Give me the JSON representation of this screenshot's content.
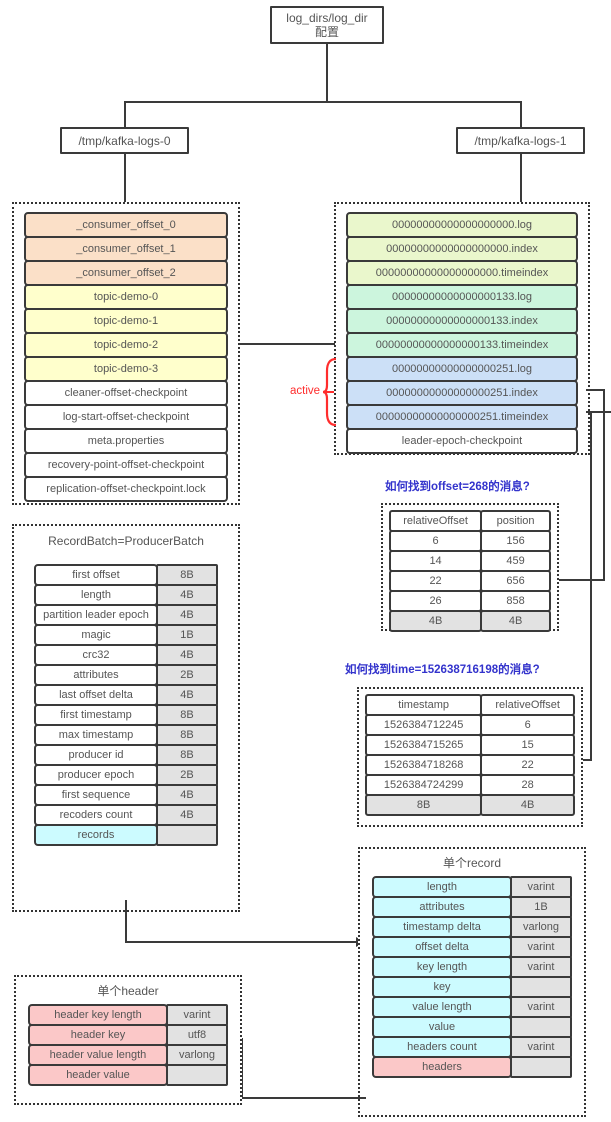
{
  "root": {
    "line1": "log_dirs/log_dir",
    "line2": "配置"
  },
  "dirs": {
    "left": "/tmp/kafka-logs-0",
    "right": "/tmp/kafka-logs-1"
  },
  "left_dir_files": [
    {
      "name": "_consumer_offset_0",
      "color": "#fbe0c8"
    },
    {
      "name": "_consumer_offset_1",
      "color": "#fbe0c8"
    },
    {
      "name": "_consumer_offset_2",
      "color": "#fbe0c8"
    },
    {
      "name": "topic-demo-0",
      "color": "#ffffcc"
    },
    {
      "name": "topic-demo-1",
      "color": "#ffffcc"
    },
    {
      "name": "topic-demo-2",
      "color": "#ffffcc"
    },
    {
      "name": "topic-demo-3",
      "color": "#ffffcc"
    },
    {
      "name": "cleaner-offset-checkpoint",
      "color": "#ffffff"
    },
    {
      "name": "log-start-offset-checkpoint",
      "color": "#ffffff"
    },
    {
      "name": "meta.properties",
      "color": "#ffffff"
    },
    {
      "name": "recovery-point-offset-checkpoint",
      "color": "#ffffff"
    },
    {
      "name": "replication-offset-checkpoint.lock",
      "color": "#ffffff"
    }
  ],
  "partition_files": [
    {
      "name": "00000000000000000000.log",
      "color": "#eaf7cc"
    },
    {
      "name": "00000000000000000000.index",
      "color": "#eaf7cc"
    },
    {
      "name": "00000000000000000000.timeindex",
      "color": "#eaf7cc"
    },
    {
      "name": "00000000000000000133.log",
      "color": "#ccf5dd"
    },
    {
      "name": "00000000000000000133.index",
      "color": "#ccf5dd"
    },
    {
      "name": "00000000000000000133.timeindex",
      "color": "#ccf5dd"
    },
    {
      "name": "00000000000000000251.log",
      "color": "#cce0f7"
    },
    {
      "name": "00000000000000000251.index",
      "color": "#cce0f7"
    },
    {
      "name": "00000000000000000251.timeindex",
      "color": "#cce0f7"
    },
    {
      "name": "leader-epoch-checkpoint",
      "color": "#ffffff"
    }
  ],
  "active_label": "active",
  "offset_index": {
    "question": "如何找到offset=268的消息?",
    "columns": [
      "relativeOffset",
      "position"
    ],
    "rows": [
      [
        "6",
        "156"
      ],
      [
        "14",
        "459"
      ],
      [
        "22",
        "656"
      ],
      [
        "26",
        "858"
      ]
    ],
    "footer": [
      "4B",
      "4B"
    ]
  },
  "time_index": {
    "question": "如何找到time=152638716198的消息?",
    "columns": [
      "timestamp",
      "relativeOffset"
    ],
    "rows": [
      [
        "1526384712245",
        "6"
      ],
      [
        "1526384715265",
        "15"
      ],
      [
        "1526384718268",
        "22"
      ],
      [
        "1526384724299",
        "28"
      ]
    ],
    "footer": [
      "8B",
      "4B"
    ]
  },
  "record_batch": {
    "title": "RecordBatch=ProducerBatch",
    "fields": [
      {
        "label": "first offset",
        "size": "8B",
        "color": "#ffffff"
      },
      {
        "label": "length",
        "size": "4B",
        "color": "#ffffff"
      },
      {
        "label": "partition leader epoch",
        "size": "4B",
        "color": "#ffffff"
      },
      {
        "label": "magic",
        "size": "1B",
        "color": "#ffffff"
      },
      {
        "label": "crc32",
        "size": "4B",
        "color": "#ffffff"
      },
      {
        "label": "attributes",
        "size": "2B",
        "color": "#ffffff"
      },
      {
        "label": "last offset delta",
        "size": "4B",
        "color": "#ffffff"
      },
      {
        "label": "first timestamp",
        "size": "8B",
        "color": "#ffffff"
      },
      {
        "label": "max timestamp",
        "size": "8B",
        "color": "#ffffff"
      },
      {
        "label": "producer id",
        "size": "8B",
        "color": "#ffffff"
      },
      {
        "label": "producer epoch",
        "size": "2B",
        "color": "#ffffff"
      },
      {
        "label": "first sequence",
        "size": "4B",
        "color": "#ffffff"
      },
      {
        "label": "recoders count",
        "size": "4B",
        "color": "#ffffff"
      },
      {
        "label": "records",
        "size": "",
        "color": "#ccfbff"
      }
    ]
  },
  "single_record": {
    "title": "单个record",
    "fields": [
      {
        "label": "length",
        "size": "varint",
        "color": "#ccfbff"
      },
      {
        "label": "attributes",
        "size": "1B",
        "color": "#ccfbff"
      },
      {
        "label": "timestamp delta",
        "size": "varlong",
        "color": "#ccfbff"
      },
      {
        "label": "offset delta",
        "size": "varint",
        "color": "#ccfbff"
      },
      {
        "label": "key length",
        "size": "varint",
        "color": "#ccfbff"
      },
      {
        "label": "key",
        "size": "",
        "color": "#ccfbff"
      },
      {
        "label": "value length",
        "size": "varint",
        "color": "#ccfbff"
      },
      {
        "label": "value",
        "size": "",
        "color": "#ccfbff"
      },
      {
        "label": "headers count",
        "size": "varint",
        "color": "#ccfbff"
      },
      {
        "label": "headers",
        "size": "",
        "color": "#fbc8c8"
      }
    ]
  },
  "single_header": {
    "title": "单个header",
    "fields": [
      {
        "label": "header key length",
        "size": "varint",
        "color": "#fbc8c8"
      },
      {
        "label": "header key",
        "size": "utf8",
        "color": "#fbc8c8"
      },
      {
        "label": "header value length",
        "size": "varlong",
        "color": "#fbc8c8"
      },
      {
        "label": "header value",
        "size": "",
        "color": "#fbc8c8"
      }
    ]
  }
}
